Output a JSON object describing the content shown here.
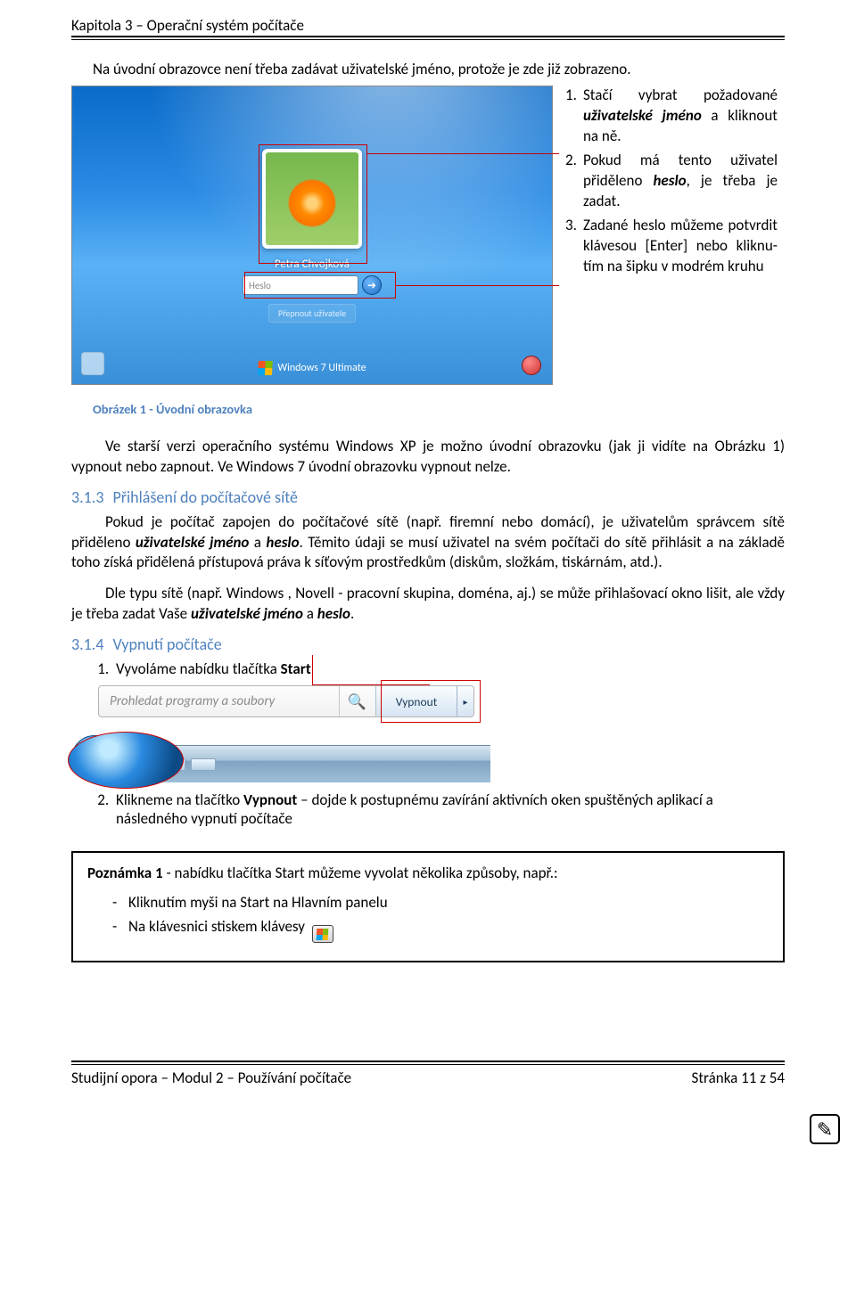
{
  "header": "Kapitola 3 – Operační systém počítače",
  "intro": "Na úvodní obrazovce není třeba zadávat uživatelské jméno, protože je zde již zobrazeno.",
  "login": {
    "username": "Petra Chvojková",
    "password_placeholder": "Heslo",
    "switch_user": "Přepnout uživatele",
    "brand": "Windows 7 Ultimate"
  },
  "steps_side": [
    {
      "pre": "Stačí vybrat požadované ",
      "bolditalic": "uživatelské jméno",
      "post": " a kliknout na ně."
    },
    {
      "pre": "Pokud má tento uživatel přiděleno ",
      "bolditalic": "heslo",
      "post": ", je třeba je zadat."
    },
    {
      "pre": "Zadané heslo můžeme po­tvrdit klávesou [Enter] nebo kliknu­tím na šipku v modrém kruhu",
      "bolditalic": "",
      "post": ""
    }
  ],
  "caption": "Obrázek 1 - Úvodní obrazovka",
  "para_xp": "Ve starší verzi operačního systému Windows XP je možno úvodní obrazovku (jak ji vidíte na Ob­rázku 1) vypnout nebo zapnout. Ve Windows 7 úvodní obrazovku vypnout nelze.",
  "sections": {
    "s313": {
      "num": "3.1.3",
      "title": "Přihlášení do počítačové sítě"
    },
    "s314": {
      "num": "3.1.4",
      "title": "Vypnutí počítače"
    }
  },
  "para_net1_a": "Pokud je počítač zapojen do počítačové sítě (např. firemní nebo domácí), je uživatelům správcem sítě přiděleno ",
  "para_net1_b": "uživatelské jméno",
  "para_net1_c": " a ",
  "para_net1_d": "heslo",
  "para_net1_e": ". Těmito údaji se musí uživatel na svém počítači do sítě přihlásit a na základě toho získá přidělená přístupová práva k síťovým prostředkům (diskům, složkám, tiskárnám, atd.).",
  "para_net2_a": "Dle typu sítě (např. Windows , Novell - pracovní skupina, doména, aj.) se může přihlašovací okno lišit, ale vždy je třeba zadat Vaše ",
  "para_net2_b": "uživatelské jméno",
  "para_net2_c": " a ",
  "para_net2_d": "heslo",
  "para_net2_e": ".",
  "shutdown_steps": {
    "s1_a": "Vyvoláme nabídku tlačítka ",
    "s1_b": "Start",
    "s2_a": "Klikneme na tlačítko ",
    "s2_b": "Vypnout",
    "s2_c": " – dojde k postupnému zavírání aktivních oken spuštěných aplikací a následného vypnutí počítače"
  },
  "start_ui": {
    "search_placeholder": "Prohledat programy a soubory",
    "shutdown_label": "Vypnout"
  },
  "note": {
    "title_a": "Poznámka 1",
    "title_b": " - nabídku tlačítka Start můžeme vyvolat několika způsoby, např.:",
    "item1": "Kliknutím myši na Start na Hlavním panelu",
    "item2": "Na klávesnici stiskem klávesy"
  },
  "footer": {
    "left": "Studijní opora – Modul 2 – Používání počítače",
    "right": "Stránka 11 z 54"
  }
}
